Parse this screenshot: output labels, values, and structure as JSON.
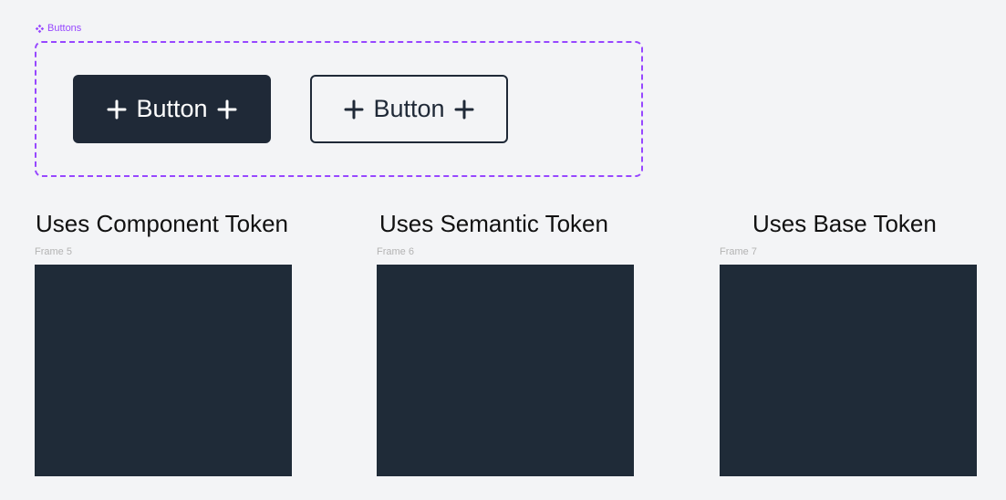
{
  "component_set": {
    "label": "Buttons",
    "accent_color": "#9747ff"
  },
  "buttons": [
    {
      "label": "Button",
      "variant": "filled",
      "color": "#1f2937"
    },
    {
      "label": "Button",
      "variant": "outlined",
      "color": "#1f2937"
    }
  ],
  "sections": [
    {
      "title": "Uses Component Token",
      "frame_label": "Frame 5"
    },
    {
      "title": "Uses Semantic Token",
      "frame_label": "Frame 6"
    },
    {
      "title": "Uses Base Token",
      "frame_label": "Frame 7"
    }
  ],
  "colors": {
    "canvas": "#f3f4f6",
    "frame_fill": "#1f2b38"
  }
}
